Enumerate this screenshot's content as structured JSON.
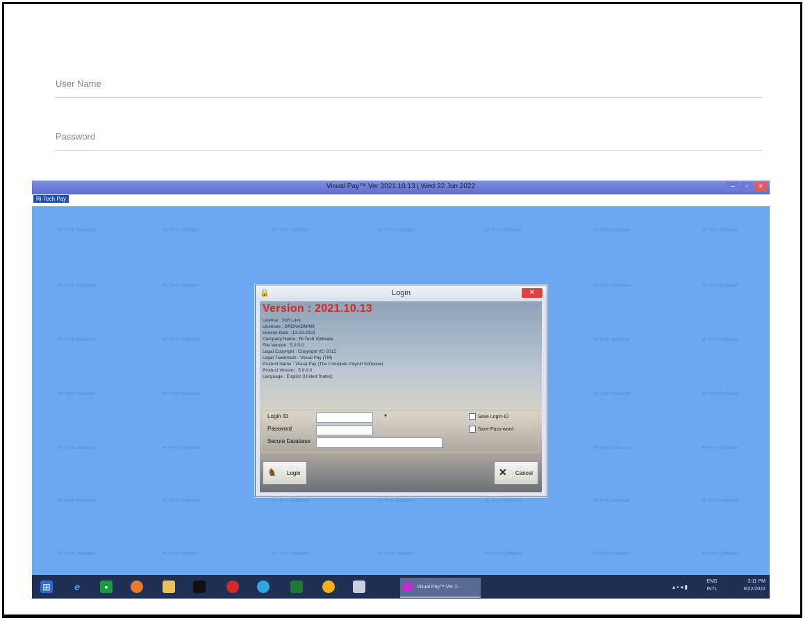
{
  "web_form": {
    "username_placeholder": "User Name",
    "password_placeholder": "Password"
  },
  "app_window": {
    "title": "Visual Pay™ Ver 2021.10.13 | Wed 22 Jun 2022",
    "menu_chip": "Ri-Tech Pay",
    "watermark_text": "Ri-Tech Software"
  },
  "login_dialog": {
    "title": "Login",
    "version_label": "Version : 2021.10.13",
    "info_lines": [
      "License : Soft Lock",
      "Licensee : DRDNADMIN9",
      "Version Date : 13-10-2021",
      "Company Name : Ri-Tech Software",
      "File Version : 5.0.0.0",
      "Legal Copyright : Copyright (C) 2015",
      "Legal Trademark : Visual Pay (TM)",
      "Product Name : Visual Pay (The Complete Payroll Software)",
      "Product Version : 5.0.0.0",
      "Language : English (United States)"
    ],
    "login_id_label": "Login ID",
    "password_label": "Password",
    "secure_database_label": "Secure Database",
    "save_login_label": "Save Login-ID",
    "save_password_label": "Save Pass-word",
    "login_button": "Login",
    "cancel_button": "Cancel",
    "dropdown_arrow": "▾"
  },
  "taskbar": {
    "active_app_label": "Visual Pay™ Ver 2...",
    "tray_lang": "ENG",
    "tray_region": "INTL",
    "tray_time": "3:11 PM",
    "tray_date": "6/22/2022",
    "colors": {
      "bar": "#1f2f55"
    }
  }
}
